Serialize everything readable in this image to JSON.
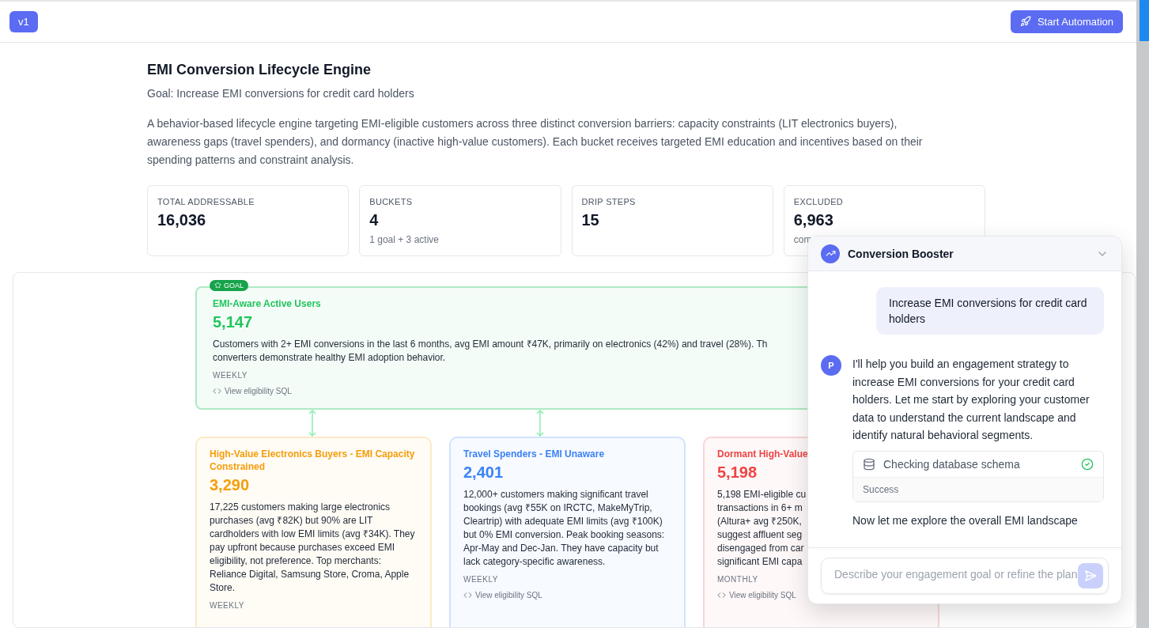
{
  "header": {
    "version": "v1",
    "action": "Start Automation"
  },
  "title": "EMI Conversion Lifecycle Engine",
  "goal": "Goal: Increase EMI conversions for credit card holders",
  "description": "A behavior-based lifecycle engine targeting EMI-eligible customers across three distinct conversion barriers: capacity constraints (LIT electronics buyers), awareness gaps (travel spenders), and dormancy (inactive high-value customers). Each bucket receives targeted EMI education and incentives based on their spending patterns and constraint analysis.",
  "stats": [
    {
      "label": "TOTAL ADDRESSABLE",
      "value": "16,036"
    },
    {
      "label": "BUCKETS",
      "value": "4",
      "sub": "1 goal + 3 active"
    },
    {
      "label": "DRIP STEPS",
      "value": "15"
    },
    {
      "label": "EXCLUDED",
      "value": "6,963",
      "sub": "com"
    }
  ],
  "goal_card": {
    "badge": "GOAL",
    "name": "EMI-Aware Active Users",
    "count": "5,147",
    "text": "Customers with 2+ EMI conversions in the last 6 months, avg EMI amount ₹47K, primarily on electronics (42%) and travel (28%). Th\nconverters demonstrate healthy EMI adoption behavior.",
    "frequency": "WEEKLY",
    "sql_link": "View eligibility SQL",
    "color": "#22c55e"
  },
  "buckets": [
    {
      "name": "High-Value Electronics Buyers - EMI Capacity Constrained",
      "count": "3,290",
      "text": "17,225 customers making large electronics purchases (avg ₹82K) but 90% are LIT cardholders with low EMI limits (avg ₹34K). They pay upfront because purchases exceed EMI eligibility, not preference. Top merchants: Reliance Digital, Samsung Store, Croma, Apple Store.",
      "frequency": "WEEKLY",
      "color": "#f59e0b"
    },
    {
      "name": "Travel Spenders - EMI Unaware",
      "count": "2,401",
      "text": "12,000+ customers making significant travel bookings (avg ₹55K on IRCTC, MakeMyTrip, Cleartrip) with adequate EMI limits (avg ₹100K) but 0% EMI conversion. Peak booking seasons: Apr-May and Dec-Jan. They have capacity but lack category-specific awareness.",
      "frequency": "WEEKLY",
      "sql_link": "View eligibility SQL",
      "color": "#3b82f6"
    },
    {
      "name": "Dormant High-Value",
      "count": "5,198",
      "text": "5,198 EMI-eligible cu\ntransactions in 6+ m\n(Altura+ avg ₹250K,\nsuggest affluent seg\ndisengaged from car\nsignificant EMI capa",
      "frequency": "MONTHLY",
      "sql_link": "View eligibility SQL",
      "color": "#ef4444"
    }
  ],
  "chat": {
    "title": "Conversion Booster",
    "expanded": true,
    "user_message": "Increase EMI conversions for credit card holders",
    "avatar": "P",
    "reply": "I'll help you build an engagement strategy to increase EMI conversions for your credit card holders. Let me start by exploring your customer data to understand the current landscape and identify natural behavioral segments.",
    "tool": {
      "name": "Checking database schema",
      "status": "Success",
      "done": true
    },
    "next": "Now let me explore the overall EMI landscape",
    "placeholder": "Describe your engagement goal or refine the plan"
  }
}
